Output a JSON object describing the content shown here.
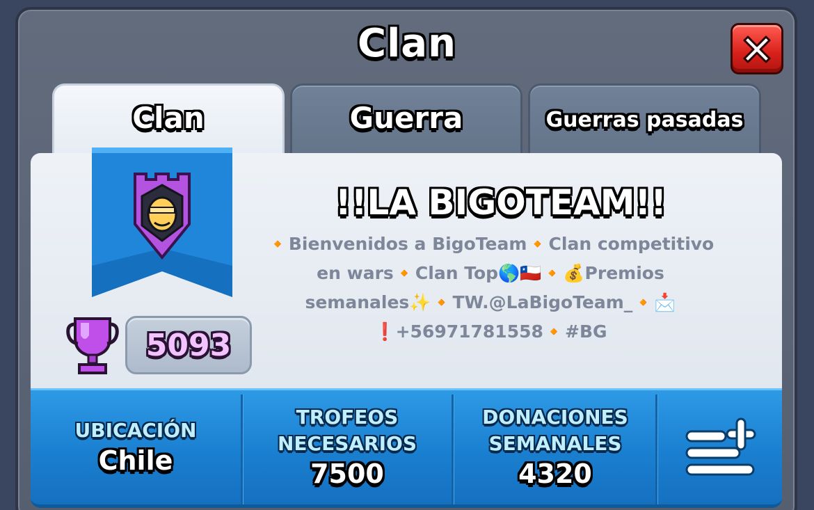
{
  "window": {
    "title": "Clan"
  },
  "close_button": {
    "icon": "close-icon"
  },
  "tabs": [
    {
      "label": "Clan",
      "active": true
    },
    {
      "label": "Guerra",
      "active": false
    },
    {
      "label": "Guerras pasadas",
      "active": false
    }
  ],
  "clan": {
    "badge_icon": "knight-shield-badge-icon",
    "trophy_icon": "trophy-icon",
    "trophies": "5093",
    "name": "!!LA BIGOTEAM!!",
    "description_lines": [
      "🔸Bienvenidos a BigoTeam🔸Clan competitivo",
      "en wars🔸Clan Top🌎🇨🇱🔸💰Premios",
      "semanales✨🔸TW.@LaBigoTeam_🔸📩",
      "❗+56971781558🔸#BG"
    ]
  },
  "stats": {
    "location": {
      "label": "UBICACIÓN",
      "value": "Chile"
    },
    "required_trophies": {
      "label_line1": "TROFEOS",
      "label_line2": "NECESARIOS",
      "value": "7500"
    },
    "weekly_donations": {
      "label_line1": "DONACIONES",
      "label_line2": "SEMANALES",
      "value": "4320"
    },
    "menu_icon": "list-add-icon"
  },
  "colors": {
    "accent_blue": "#1a7fd0",
    "close_red": "#d8201a",
    "trophy_purple": "#c04ee8"
  }
}
